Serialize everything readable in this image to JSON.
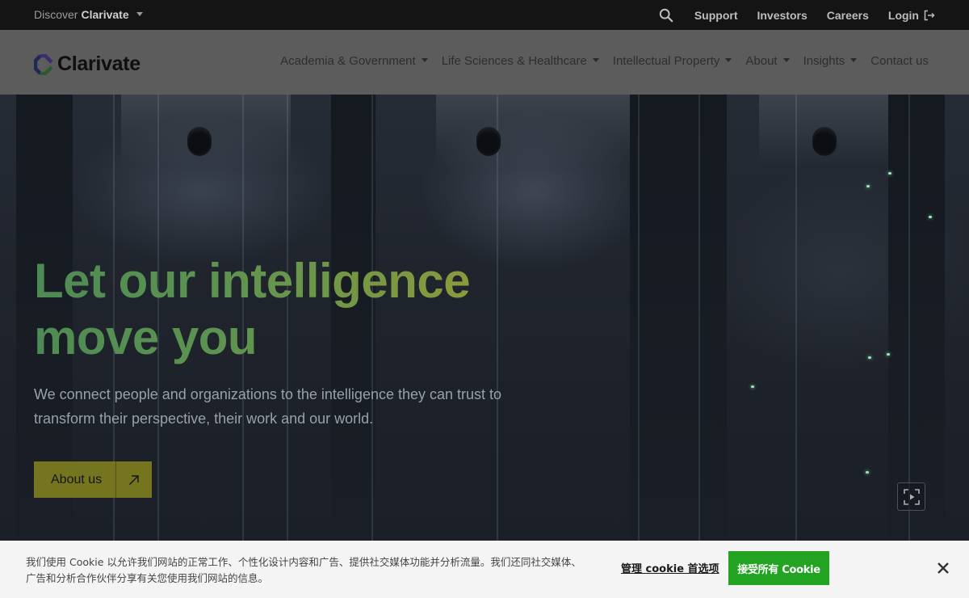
{
  "topbar": {
    "discover_prefix": "Discover",
    "discover_brand": "Clarivate",
    "links": [
      "Support",
      "Investors",
      "Careers",
      "Login"
    ],
    "icons": [
      "search-icon",
      "login-icon",
      "chevron-down-icon"
    ]
  },
  "header": {
    "logo_text": "Clarivate",
    "nav": [
      {
        "label": "Academia & Government",
        "dropdown": true
      },
      {
        "label": "Life Sciences & Healthcare",
        "dropdown": true
      },
      {
        "label": "Intellectual Property",
        "dropdown": true
      },
      {
        "label": "About",
        "dropdown": true
      },
      {
        "label": "Insights",
        "dropdown": true
      },
      {
        "label": "Contact us",
        "dropdown": false
      }
    ]
  },
  "hero": {
    "headline_line1": "Let our intelligence",
    "headline_line2": "move you",
    "subtext": "We connect people and organizations to the intelligence they can trust to transform their perspective, their work and our world.",
    "cta_label": "About us",
    "icons": [
      "arrow-up-right-icon",
      "fullscreen-icon"
    ]
  },
  "cookie": {
    "text": "我们使用 Cookie 以允许我们网站的正常工作、个性化设计内容和广告、提供社交媒体功能并分析流量。我们还同社交媒体、广告和分析合作伙伴分享有关您使用我们网站的信息。",
    "manage_label": "管理 cookie 首选项",
    "accept_label": "接受所有 Cookie",
    "icons": [
      "close-icon"
    ]
  },
  "colors": {
    "accent_green": "#22a422",
    "cta_olive": "#75751f",
    "headline_gradient_start": "#4e8a55",
    "headline_gradient_end": "#8a9a3c"
  }
}
